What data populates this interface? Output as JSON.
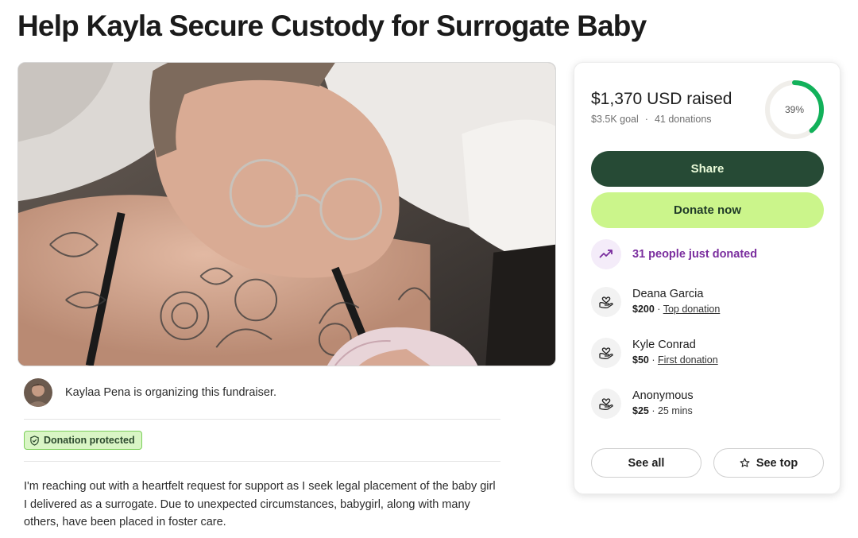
{
  "page": {
    "title": "Help Kayla Secure Custody for Surrogate Baby"
  },
  "organizer": {
    "text": "Kaylaa Pena is organizing this fundraiser."
  },
  "badge": {
    "label": "Donation protected"
  },
  "story": {
    "text": "I'm reaching out with a heartfelt request for support as I seek legal placement of the baby girl I delivered as a surrogate. Due to unexpected circumstances, babygirl, along with many others, have been placed in foster care."
  },
  "card": {
    "raised": "$1,370 USD raised",
    "goal": "$3.5K goal",
    "separator": "·",
    "donations_count": "41 donations",
    "progress_label": "39%",
    "progress_fraction": 0.39,
    "share_label": "Share",
    "donate_label": "Donate now",
    "trend_text": "31 people just donated",
    "donations": [
      {
        "name": "Deana Garcia",
        "amount": "$200",
        "sep": " · ",
        "note": "Top donation",
        "note_is_link": true
      },
      {
        "name": "Kyle Conrad",
        "amount": "$50",
        "sep": " · ",
        "note": "First donation",
        "note_is_link": true
      },
      {
        "name": "Anonymous",
        "amount": "$25",
        "sep": " · ",
        "note": "25 mins",
        "note_is_link": false
      }
    ],
    "see_all_label": "See all",
    "see_top_label": "See top"
  },
  "colors": {
    "share_bg": "#264a35",
    "donate_bg": "#cbf58b",
    "progress_green": "#12b15a",
    "trend_purple": "#7a2d9e",
    "badge_bg": "#d9f5c5"
  },
  "icons": {
    "badge": "shield-icon",
    "trend": "trending-up-icon",
    "donation": "heart-hand-icon",
    "see_top": "star-icon"
  }
}
